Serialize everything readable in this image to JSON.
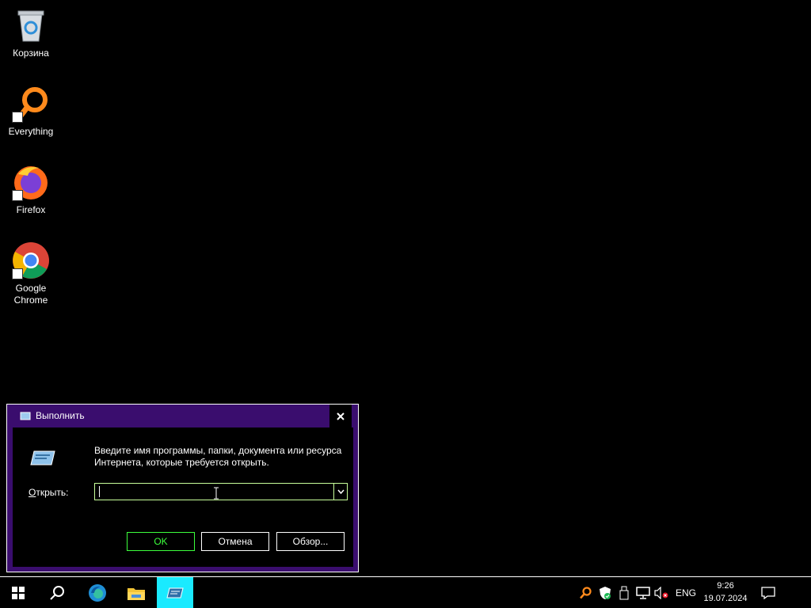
{
  "desktop": {
    "icons": [
      {
        "label": "Корзина",
        "icon": "recycle-bin-icon"
      },
      {
        "label": "Everything",
        "icon": "everything-search-icon"
      },
      {
        "label": "Firefox",
        "icon": "firefox-icon"
      },
      {
        "label": "Google Chrome",
        "icon": "chrome-icon"
      }
    ]
  },
  "run_dialog": {
    "title": "Выполнить",
    "prompt_line1": "Введите имя программы, папки, документа или ресурса",
    "prompt_line2": "Интернета, которые требуется открыть.",
    "open_label_accel": "О",
    "open_label_rest": "ткрыть:",
    "input_value": "",
    "buttons": {
      "ok": "OK",
      "cancel": "Отмена",
      "browse": "Обзор..."
    }
  },
  "taskbar": {
    "apps": [
      "start-icon",
      "search-icon",
      "edge-icon",
      "file-explorer-icon",
      "run-icon"
    ],
    "language": "ENG",
    "time": "9:26",
    "date": "19.07.2024"
  },
  "colors": {
    "title_bar": "#3a0d6e",
    "ok_border": "#3cff3c",
    "input_border": "#c8ff9a",
    "active_task": "#1aeaff"
  }
}
